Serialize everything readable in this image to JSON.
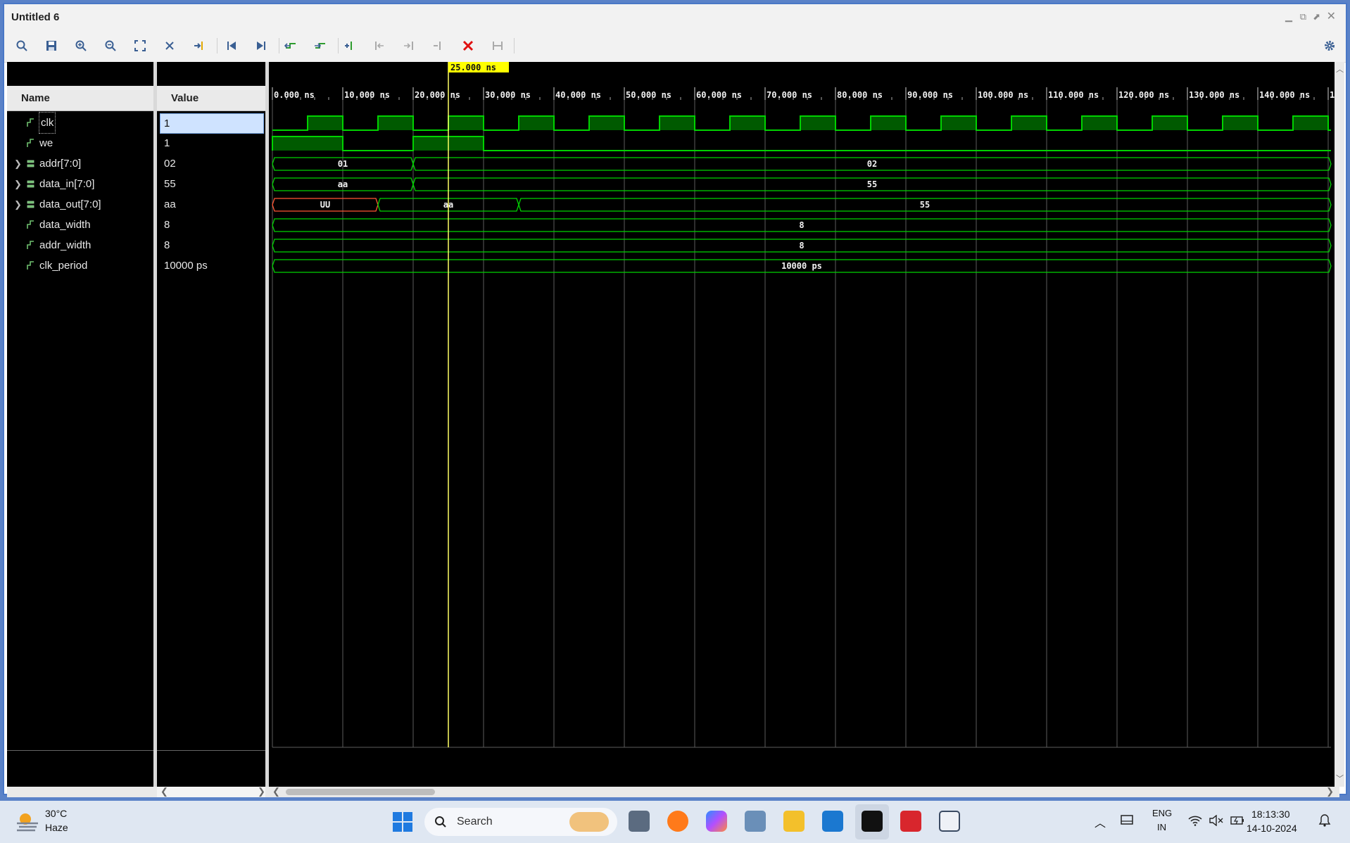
{
  "window": {
    "title": "Untitled 6"
  },
  "toolbar": {
    "icons": [
      "search-icon",
      "save-icon",
      "zoom-in-icon",
      "zoom-out-icon",
      "zoom-fit-icon",
      "swap-cursor-icon",
      "go-to-cursor-icon",
      "go-to-time-zero-icon",
      "go-to-last-time-icon",
      "previous-transition-icon",
      "next-transition-icon",
      "add-marker-icon",
      "previous-marker-icon",
      "next-marker-icon",
      "delete-marker-icon",
      "delete-all-markers-icon",
      "snap-icon",
      "settings-icon"
    ]
  },
  "columns": {
    "name": "Name",
    "value": "Value"
  },
  "signals": [
    {
      "name": "clk",
      "value": "1",
      "expandable": false,
      "selected": true
    },
    {
      "name": "we",
      "value": "1",
      "expandable": false,
      "selected": false
    },
    {
      "name": "addr[7:0]",
      "value": "02",
      "expandable": true,
      "selected": false
    },
    {
      "name": "data_in[7:0]",
      "value": "55",
      "expandable": true,
      "selected": false
    },
    {
      "name": "data_out[7:0]",
      "value": "aa",
      "expandable": true,
      "selected": false
    },
    {
      "name": "data_width",
      "value": "8",
      "expandable": false,
      "selected": false
    },
    {
      "name": "addr_width",
      "value": "8",
      "expandable": false,
      "selected": false
    },
    {
      "name": "clk_period",
      "value": "10000 ps",
      "expandable": false,
      "selected": false
    }
  ],
  "timeline": {
    "cursor_label": "25.000 ns",
    "cursor_time_ns": 25,
    "visible_start_ns": 0,
    "visible_end_ns": 151,
    "tick_labels": [
      "0.000 ns",
      "10.000 ns",
      "20.000 ns",
      "30.000 ns",
      "40.000 ns",
      "50.000 ns",
      "60.000 ns",
      "70.000 ns",
      "80.000 ns",
      "90.000 ns",
      "100.000 ns",
      "110.000 ns",
      "120.000 ns",
      "130.000 ns",
      "140.000 ns",
      "1"
    ]
  },
  "waves": {
    "clk": {
      "period_ns": 10,
      "rise_offset_ns": 5
    },
    "we": {
      "high_intervals_ns": [
        [
          0,
          10
        ],
        [
          20,
          30
        ]
      ]
    },
    "addr": [
      {
        "from": 0,
        "to": 20,
        "label": "01"
      },
      {
        "from": 20,
        "to": 151,
        "label": "02"
      }
    ],
    "data_in": [
      {
        "from": 0,
        "to": 20,
        "label": "aa"
      },
      {
        "from": 20,
        "to": 151,
        "label": "55"
      }
    ],
    "data_out": [
      {
        "from": 0,
        "to": 15,
        "label": "UU"
      },
      {
        "from": 15,
        "to": 35,
        "label": "aa"
      },
      {
        "from": 35,
        "to": 151,
        "label": "55"
      }
    ],
    "data_width": [
      {
        "from": 0,
        "to": 151,
        "label": "8"
      }
    ],
    "addr_width": [
      {
        "from": 0,
        "to": 151,
        "label": "8"
      }
    ],
    "clk_period": [
      {
        "from": 0,
        "to": 151,
        "label": "10000 ps"
      }
    ]
  },
  "colors": {
    "wave": "#00d200",
    "wave_fill": "#005a00",
    "undefined": "#ff5533",
    "cursor": "#ffff66",
    "cursor_label_bg": "#ffff00",
    "grid": "#5c5c5c"
  },
  "taskbar": {
    "weather_temp": "30°C",
    "weather_desc": "Haze",
    "search_label": "Search",
    "lang_line1": "ENG",
    "lang_line2": "IN",
    "time": "18:13:30",
    "date": "14-10-2024"
  }
}
